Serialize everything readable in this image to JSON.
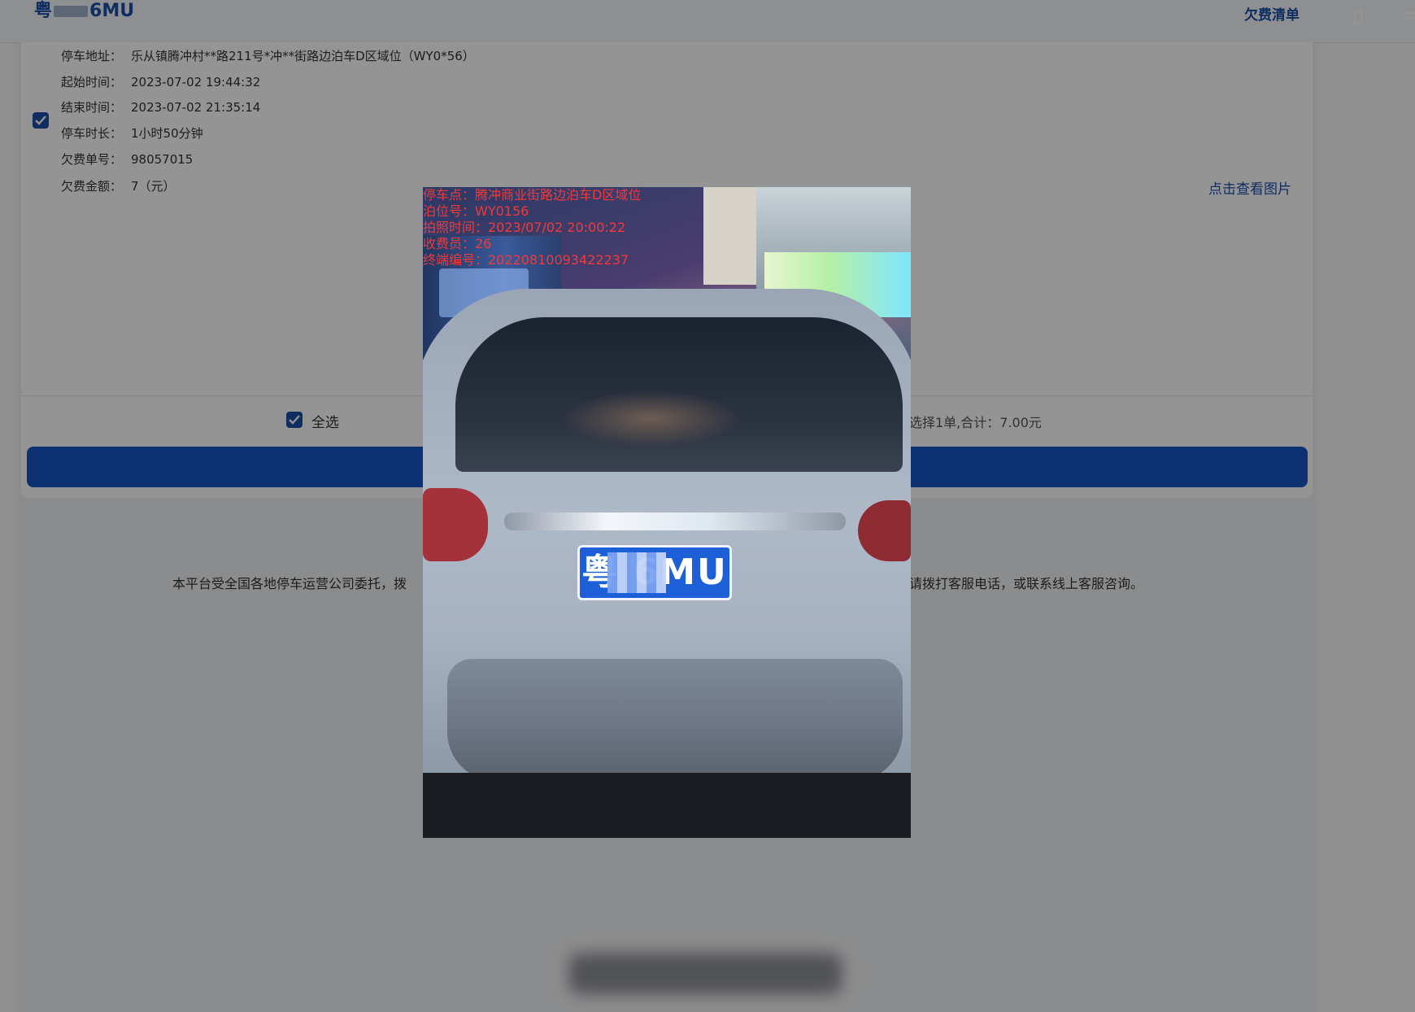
{
  "header": {
    "plate_prefix": "粤",
    "plate_suffix": "6MU",
    "debt_list_label": "欠费清单"
  },
  "record": {
    "rows": [
      {
        "label": "停车地址：",
        "value": "乐从镇腾冲村**路211号*冲**街路边泊车D区域位（WY0*56）"
      },
      {
        "label": "起始时间：",
        "value": "2023-07-02 19:44:32"
      },
      {
        "label": "结束时间：",
        "value": "2023-07-02 21:35:14"
      },
      {
        "label": "停车时长：",
        "value": "1小时50分钟"
      },
      {
        "label": "欠费单号：",
        "value": "98057015"
      },
      {
        "label": "欠费金额：",
        "value": "7（元）"
      }
    ],
    "view_photo_label": "点击查看图片",
    "checked": true
  },
  "footer": {
    "select_all_label": "全选",
    "summary": "选择1单,合计：7.00元",
    "pay_button_color": "#1555c7"
  },
  "notice": {
    "left": "本平台受全国各地停车运营公司委托，拨",
    "right": "请拨打客服电话，或联系线上客服咨询。"
  },
  "photo": {
    "info": [
      "停车点：腾冲商业街路边泊车D区域位",
      "泊位号：WY0156",
      "拍照时间：2023/07/02 20:00:22",
      "收费员：26",
      "终端编号：20220810093422237"
    ],
    "plate_text": "粤    6MU",
    "info_color": "#f03a3a"
  },
  "colors": {
    "accent": "#1a4fa8",
    "overlay": "rgba(0,0,0,0.42)"
  }
}
